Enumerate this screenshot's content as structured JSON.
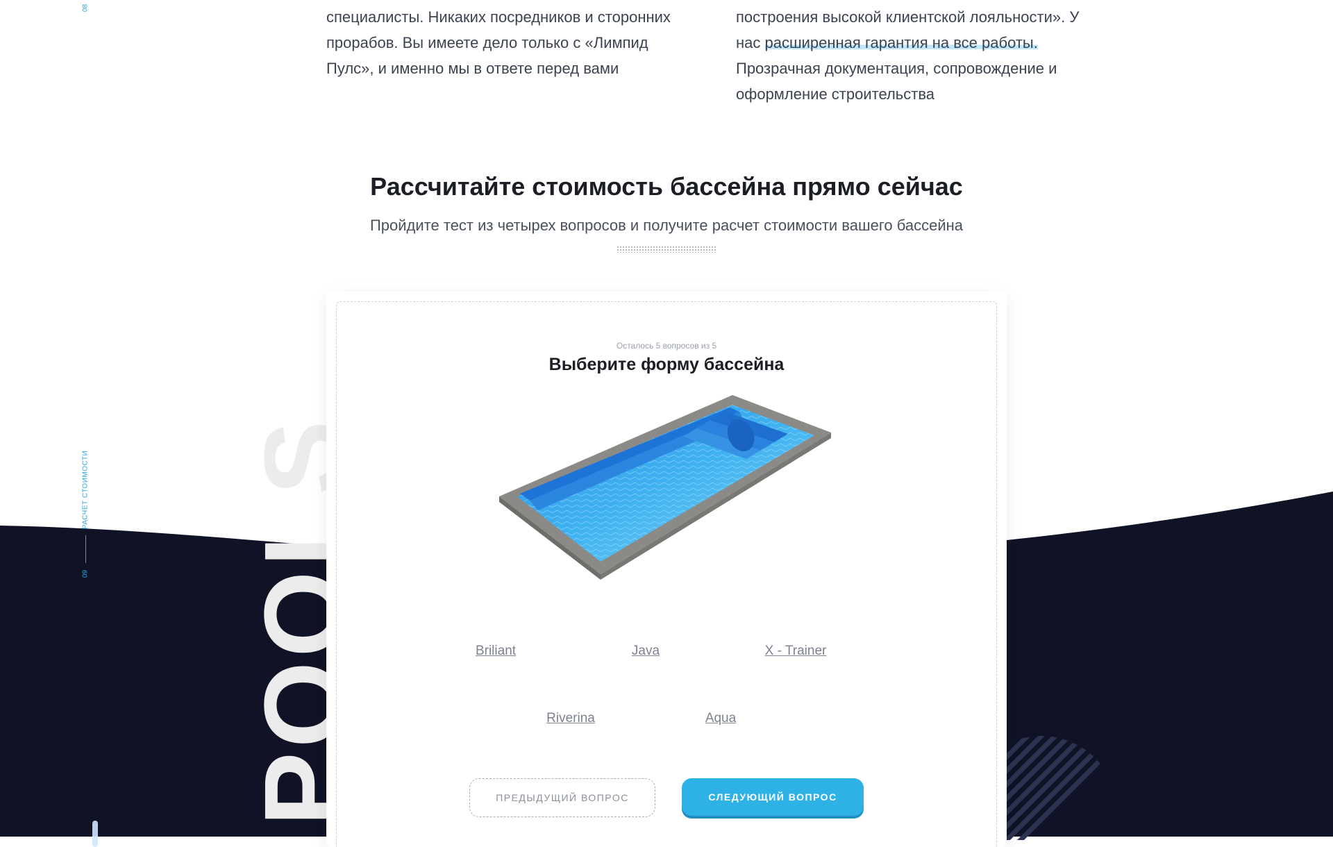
{
  "side_nav": {
    "prev_number": "08",
    "current_number": "09",
    "current_label": "Расчет стоимости"
  },
  "intro": {
    "left_paragraph": "специалисты. Никаких посредников и сторонних прорабов. Вы имеете дело только с «Лимпид Пулс», и именно мы в ответе перед вами",
    "right_paragraph_start": "построения высокой клиентской лояльности». У нас ",
    "right_paragraph_highlight": "расширенная гарантия на все работы.",
    "right_paragraph_end": " Прозрачная документация, сопровождение и оформление строительства"
  },
  "section": {
    "title": "Рассчитайте стоимость бассейна прямо сейчас",
    "subtitle": "Пройдите тест из четырех вопросов и получите расчет стоимости вашего бассейна",
    "watermark": "POOLS"
  },
  "quiz": {
    "progress": "Осталось 5 вопросов из 5",
    "question": "Выберите форму бассейна",
    "options": [
      "Briliant",
      "Java",
      "X - Trainer",
      "Riverina",
      "Aqua"
    ],
    "prev_label": "Предыдущий вопрос",
    "next_label": "Следующий вопрос"
  },
  "colors": {
    "accent": "#2eb2e6",
    "dark_background": "#0f1325",
    "highlight": "#bfe6fb"
  }
}
